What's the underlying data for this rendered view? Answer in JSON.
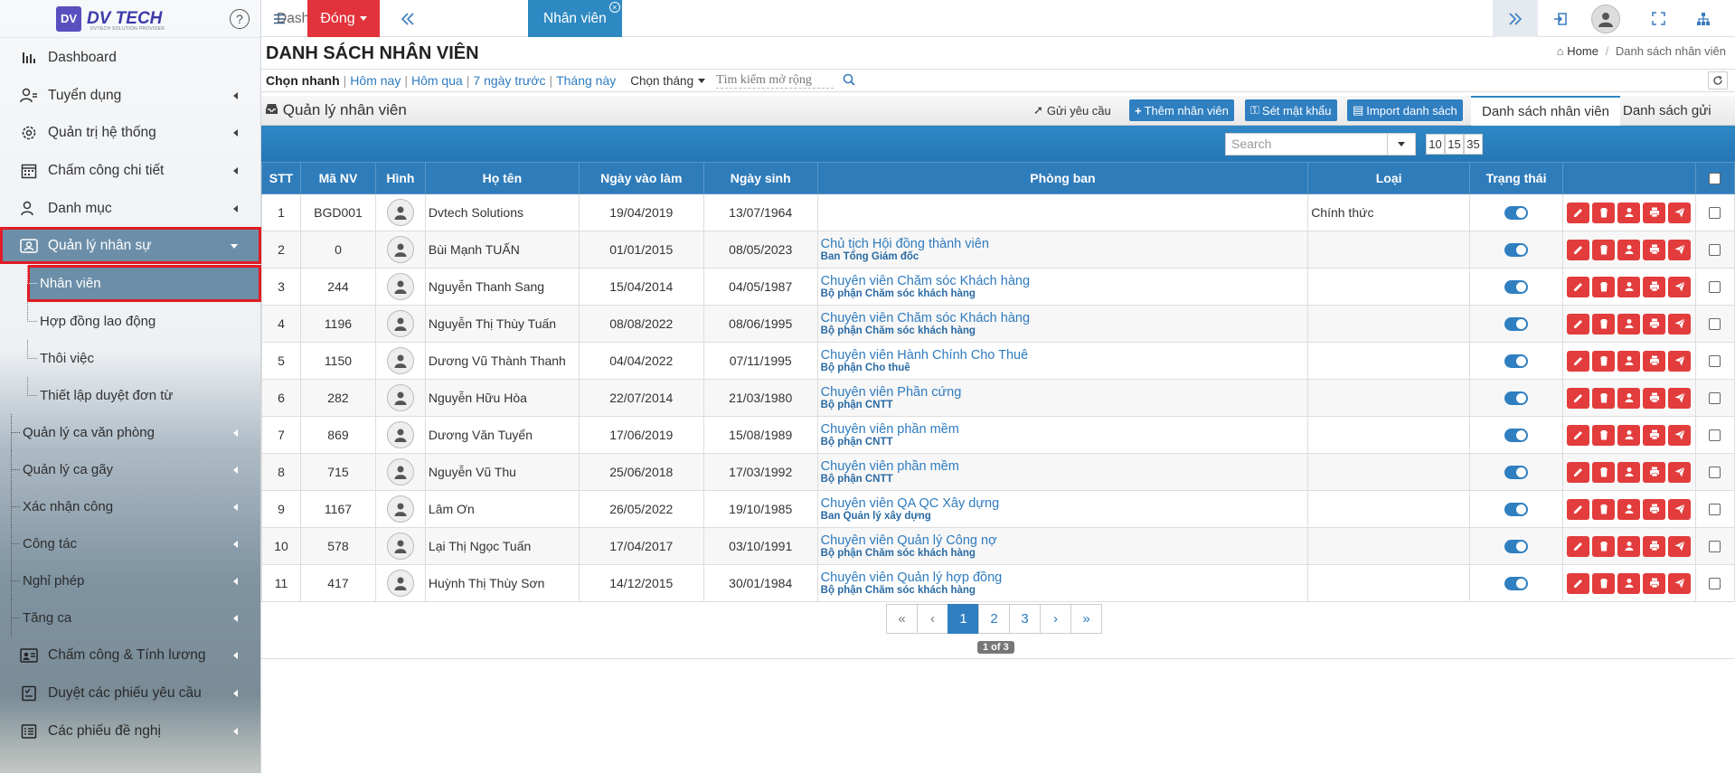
{
  "app": {
    "logo_mark": "DV",
    "logo_text": "DV TECH",
    "logo_sub": "DVTECH SOLUTION PROVIDER",
    "help": "?"
  },
  "sidebar": {
    "items": [
      {
        "label": "Dashboard",
        "icon": "bar-chart-icon"
      },
      {
        "label": "Tuyển dụng",
        "icon": "user-search-icon"
      },
      {
        "label": "Quản trị hệ thống",
        "icon": "gear-icon"
      },
      {
        "label": "Chấm công chi tiết",
        "icon": "calendar-icon"
      },
      {
        "label": "Danh mục",
        "icon": "user-list-icon"
      },
      {
        "label": "Quản lý nhân sự",
        "icon": "id-card-icon"
      }
    ],
    "sub_items": [
      {
        "label": "Nhân viên"
      },
      {
        "label": "Hợp đồng lao động"
      },
      {
        "label": "Thôi việc"
      },
      {
        "label": "Thiết lập duyệt đơn từ"
      }
    ],
    "tree_items": [
      {
        "label": "Quản lý ca văn phòng"
      },
      {
        "label": "Quản lý ca gãy"
      },
      {
        "label": "Xác nhận công"
      },
      {
        "label": "Công tác"
      },
      {
        "label": "Nghỉ phép"
      },
      {
        "label": "Tăng ca"
      }
    ],
    "bottom_items": [
      {
        "label": "Chấm công & Tính lương",
        "icon": "payroll-icon"
      },
      {
        "label": "Duyệt các phiếu yêu cầu",
        "icon": "checklist-icon"
      },
      {
        "label": "Các phiếu đề nghị",
        "icon": "list-icon"
      }
    ]
  },
  "topbar": {
    "dong_label": "Đóng",
    "tabs": [
      {
        "label": "Dashboard"
      },
      {
        "label": "Nhân viên",
        "close": "×"
      }
    ]
  },
  "page": {
    "title": "DANH SÁCH NHÂN VIÊN",
    "breadcrumb_home": "Home",
    "breadcrumb_current": "Danh sách nhân viên"
  },
  "filter": {
    "label": "Chọn nhanh",
    "links": [
      "Hôm nay",
      "Hôm qua",
      "7 ngày trước",
      "Tháng này"
    ],
    "month_label": "Chọn tháng",
    "search_placeholder": "Tìm kiếm mở rộng"
  },
  "section": {
    "title": "Quản lý nhân viên",
    "send_request": "Gửi yêu cầu",
    "add_employee": "Thêm nhân viên",
    "set_password": "Sét mật khẩu",
    "import_list": "Import danh sách",
    "tab_list": "Danh sách nhân viên",
    "tab_sent": "Danh sách gửi"
  },
  "toolbar": {
    "page_sizes": [
      "10",
      "15",
      "35"
    ],
    "search_placeholder": "Search"
  },
  "table": {
    "headers": [
      "STT",
      "Mã NV",
      "Hình",
      "Họ tên",
      "Ngày vào làm",
      "Ngày sinh",
      "Phòng ban",
      "Loại",
      "Trạng thái"
    ],
    "rows": [
      {
        "stt": "1",
        "code": "BGD001",
        "name": "Dvtech Solutions",
        "start": "19/04/2019",
        "dob": "13/07/1964",
        "role": "",
        "dept": "",
        "type": "Chính thức"
      },
      {
        "stt": "2",
        "code": "0",
        "name": "Bùi Mạnh TUẤN",
        "start": "01/01/2015",
        "dob": "08/05/2023",
        "role": "Chủ tịch Hội đồng thành viên",
        "dept": "Ban Tổng Giám đốc",
        "type": ""
      },
      {
        "stt": "3",
        "code": "244",
        "name": "Nguyễn Thanh Sang",
        "start": "15/04/2014",
        "dob": "04/05/1987",
        "role": "Chuyên viên Chăm sóc Khách hàng",
        "dept": "Bộ phận Chăm sóc khách hàng",
        "type": ""
      },
      {
        "stt": "4",
        "code": "1196",
        "name": "Nguyễn Thị Thùy Tuấn",
        "start": "08/08/2022",
        "dob": "08/06/1995",
        "role": "Chuyên viên Chăm sóc Khách hàng",
        "dept": "Bộ phận Chăm sóc khách hàng",
        "type": ""
      },
      {
        "stt": "5",
        "code": "1150",
        "name": "Dương Vũ Thành Thanh",
        "start": "04/04/2022",
        "dob": "07/11/1995",
        "role": "Chuyên viên Hành Chính Cho Thuê",
        "dept": "Bộ phận Cho thuê",
        "type": ""
      },
      {
        "stt": "6",
        "code": "282",
        "name": "Nguyễn Hữu Hòa",
        "start": "22/07/2014",
        "dob": "21/03/1980",
        "role": "Chuyên viên Phần cứng",
        "dept": "Bộ phận CNTT",
        "type": ""
      },
      {
        "stt": "7",
        "code": "869",
        "name": "Dương Văn Tuyển",
        "start": "17/06/2019",
        "dob": "15/08/1989",
        "role": "Chuyên viên phần mềm",
        "dept": "Bộ phận CNTT",
        "type": ""
      },
      {
        "stt": "8",
        "code": "715",
        "name": "Nguyễn Vũ Thu",
        "start": "25/06/2018",
        "dob": "17/03/1992",
        "role": "Chuyên viên phần mềm",
        "dept": "Bộ phận CNTT",
        "type": ""
      },
      {
        "stt": "9",
        "code": "1167",
        "name": "Lâm Ơn",
        "start": "26/05/2022",
        "dob": "19/10/1985",
        "role": "Chuyên viên QA QC Xây dựng",
        "dept": "Ban Quản lý xây dựng",
        "type": ""
      },
      {
        "stt": "10",
        "code": "578",
        "name": "Lại Thị Ngọc Tuấn",
        "start": "17/04/2017",
        "dob": "03/10/1991",
        "role": "Chuyên viên Quản lý Công nợ",
        "dept": "Bộ phận Chăm sóc khách hàng",
        "type": ""
      },
      {
        "stt": "11",
        "code": "417",
        "name": "Huỳnh Thị Thùy Sơn",
        "start": "14/12/2015",
        "dob": "30/01/1984",
        "role": "Chuyên viên Quản lý hợp đồng",
        "dept": "Bộ phận Chăm sóc khách hàng",
        "type": ""
      }
    ]
  },
  "pagination": {
    "first": "«",
    "prev": "‹",
    "pages": [
      "1",
      "2",
      "3"
    ],
    "next": "›",
    "last": "»",
    "info": "1 of 3"
  },
  "colors": {
    "accent": "#2f7fc1",
    "danger": "#e23c3c",
    "highlight": "#e01b24"
  }
}
